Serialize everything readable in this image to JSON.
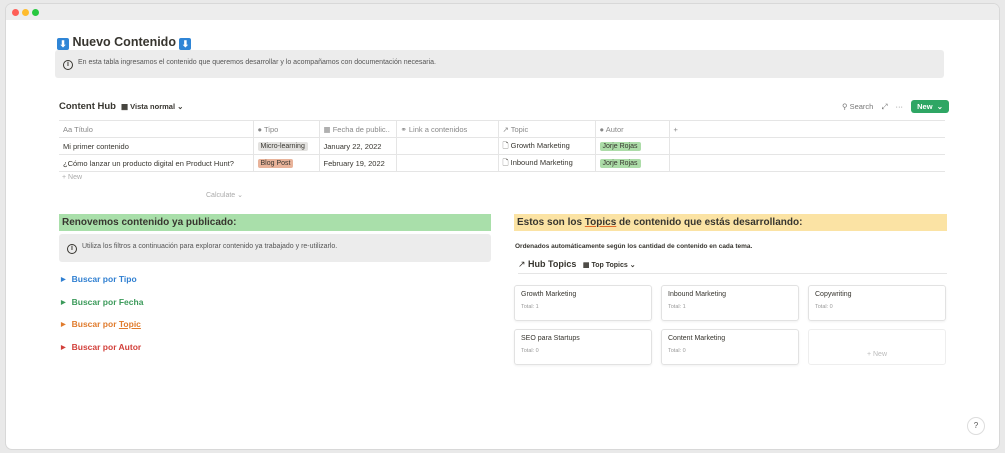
{
  "window": {
    "dots": [
      "#fe5f57",
      "#febc2e",
      "#28c840"
    ]
  },
  "page": {
    "title": "Nuevo Contenido",
    "title_icon": "down-arrow-icon",
    "callout_text": "En esta tabla ingresamos el contenido que queremos desarrollar y lo acompañamos con documentación necesaria."
  },
  "database": {
    "title": "Content Hub",
    "view": "Vista normal",
    "search_label": "Search",
    "new_label": "New",
    "columns": [
      {
        "label": "Título",
        "icon": "Aa"
      },
      {
        "label": "Tipo",
        "icon": "●"
      },
      {
        "label": "Fecha de public..",
        "icon": "▦"
      },
      {
        "label": "Link a contenidos",
        "icon": "⚭"
      },
      {
        "label": "Topic",
        "icon": "↗"
      },
      {
        "label": "Autor",
        "icon": "●"
      }
    ],
    "rows": [
      {
        "titulo": "Mi primer contenido",
        "tipo": "Micro-learning",
        "tipo_color": "#e3e2e0",
        "fecha": "January 22, 2022",
        "link": "",
        "topic": "Growth Marketing",
        "autor": "Jorje Rojas"
      },
      {
        "titulo": "¿Cómo lanzar un producto digital en Product Hunt?",
        "tipo": "Blog Post",
        "tipo_color": "#e8b39a",
        "fecha": "February 19, 2022",
        "link": "",
        "topic": "Inbound Marketing",
        "autor": "Jorje Rojas"
      }
    ],
    "add_row": "+ New",
    "calculate": "Calculate ⌄"
  },
  "left": {
    "heading": "Renovemos contenido ya publicado:",
    "callout": "Utiliza los filtros a continuación para explorar contenido ya trabajado y re-utilizarlo.",
    "toggles": [
      {
        "label": "Buscar por Tipo",
        "color": "#2f7fd1"
      },
      {
        "label": "Buscar por Fecha",
        "color": "#3b9a5a"
      },
      {
        "label_a": "Buscar por ",
        "label_b": "Topic",
        "color": "#e07b2c"
      },
      {
        "label": "Buscar por Autor",
        "color": "#d23f3a"
      }
    ]
  },
  "right": {
    "heading_a": "Estos son los ",
    "heading_b": "Topics",
    "heading_c": " de contenido que estás desarrollando:",
    "subtitle": "Ordenados automáticamente según los cantidad de contenido en cada tema.",
    "hub_title": "Hub Topics",
    "hub_view": "Top Topics",
    "cards": [
      {
        "title": "Growth Marketing",
        "total": "Total: 1"
      },
      {
        "title": "Inbound Marketing",
        "total": "Total: 1"
      },
      {
        "title": "Copywriting",
        "total": "Total: 0"
      },
      {
        "title": "SEO para Startups",
        "total": "Total: 0"
      },
      {
        "title": "Content Marketing",
        "total": "Total: 0"
      }
    ],
    "new_card": "+ New"
  },
  "help": "?"
}
